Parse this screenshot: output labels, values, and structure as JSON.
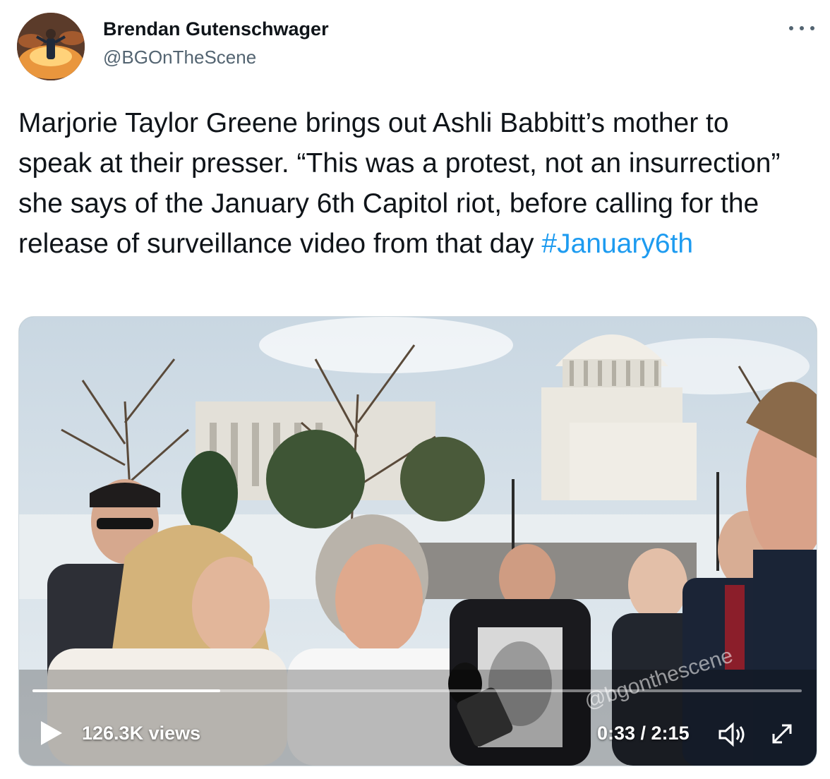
{
  "author": {
    "display_name": "Brendan Gutenschwager",
    "handle": "@BGOnTheScene",
    "avatar_icon": "profile-photo"
  },
  "more_icon": "ellipsis-icon",
  "tweet": {
    "text": "Marjorie Taylor Greene brings out Ashli Babbitt’s mother to speak at their presser. “This was a protest, not an insurrection” she says of the January 6th Capitol riot, before calling for the release of surveillance video from that day ",
    "hashtag": "#January6th",
    "hashtag_color": "#1d9bf0"
  },
  "video": {
    "views": "126.3K views",
    "time": "0:33 / 2:15",
    "progress": 0.244,
    "watermark": "@bgonthescene",
    "controls": {
      "play_icon": "play-icon",
      "volume_icon": "volume-icon",
      "fullscreen_icon": "fullscreen-icon"
    }
  }
}
